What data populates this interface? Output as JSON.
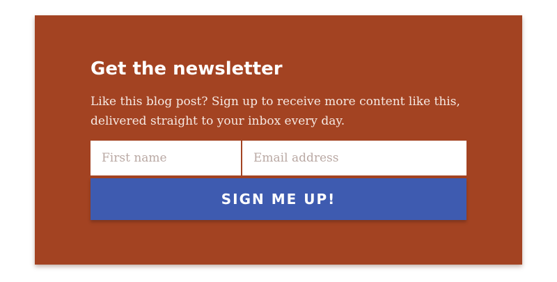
{
  "newsletter": {
    "title": "Get the newsletter",
    "description": "Like this blog post? Sign up to receive more content like this, delivered straight to your inbox every day.",
    "first_name_placeholder": "First name",
    "email_placeholder": "Email address",
    "submit_label": "SIGN ME UP!"
  },
  "colors": {
    "card": "#a34322",
    "button": "#3e5bb0"
  }
}
